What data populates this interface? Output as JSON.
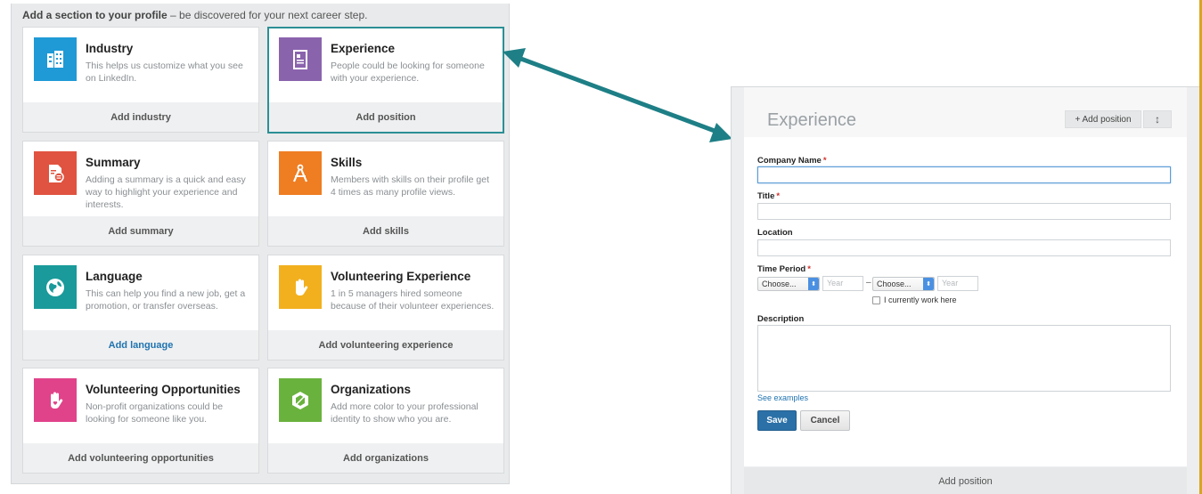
{
  "left": {
    "header_bold": "Add a section to your profile",
    "header_rest": " – be discovered for your next career step.",
    "cards": [
      {
        "title": "Industry",
        "desc": "This helps us customize what you see on LinkedIn.",
        "action": "Add industry",
        "color": "#1f9ad6",
        "icon": "building-icon"
      },
      {
        "title": "Experience",
        "desc": "People could be looking for someone with your experience.",
        "action": "Add position",
        "color": "#8a63ad",
        "icon": "document-icon"
      },
      {
        "title": "Summary",
        "desc": "Adding a summary is a quick and easy way to highlight your experience and interests.",
        "action": "Add summary",
        "color": "#e05340",
        "icon": "summary-doc-icon"
      },
      {
        "title": "Skills",
        "desc": "Members with skills on their profile get 4 times as many profile views.",
        "action": "Add skills",
        "color": "#ef7d22",
        "icon": "compass-icon"
      },
      {
        "title": "Language",
        "desc": "This can help you find a new job, get a promotion, or transfer overseas.",
        "action": "Add language",
        "color": "#1a9a9a",
        "icon": "globe-icon"
      },
      {
        "title": "Volunteering Experience",
        "desc": "1 in 5 managers hired someone because of their volunteer experiences.",
        "action": "Add volunteering experience",
        "color": "#f2b01e",
        "icon": "raised-hand-icon"
      },
      {
        "title": "Volunteering Opportunities",
        "desc": "Non-profit organizations could be looking for someone like you.",
        "action": "Add volunteering opportunities",
        "color": "#e0438a",
        "icon": "heart-hand-icon"
      },
      {
        "title": "Organizations",
        "desc": "Add more color to your professional identity to show who you are.",
        "action": "Add organizations",
        "color": "#6ab23e",
        "icon": "badge-icon"
      }
    ]
  },
  "right": {
    "title": "Experience",
    "add_position": "+ Add position",
    "sort_icon": "↕",
    "labels": {
      "company": "Company Name",
      "title": "Title",
      "location": "Location",
      "time_period": "Time Period",
      "description": "Description"
    },
    "required": "*",
    "choose": "Choose...",
    "year_placeholder": "Year",
    "dash": "–",
    "current_work": "I currently work here",
    "see_examples": "See examples",
    "save": "Save",
    "cancel": "Cancel",
    "footer": "Add position"
  },
  "colors": {
    "arrow": "#1e7f86",
    "accent_border": "#2c8f95"
  }
}
